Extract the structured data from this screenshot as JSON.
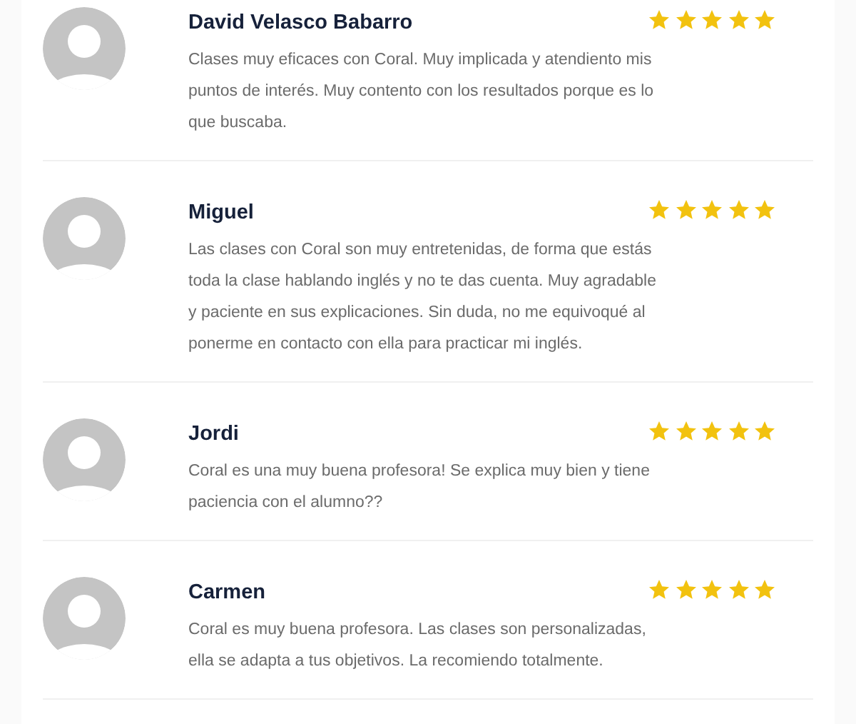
{
  "reviews": [
    {
      "name": "David Velasco Babarro",
      "text": "Clases muy eficaces con Coral. Muy implicada y atendiento mis puntos de interés. Muy contento con los resultados porque es lo que buscaba.",
      "stars": 5
    },
    {
      "name": "Miguel",
      "text": "Las clases con Coral son muy entretenidas, de forma que estás toda la clase hablando inglés y no te das cuenta. Muy agradable y paciente en sus explicaciones. Sin duda, no me equivoqué al ponerme en contacto con ella para practicar mi inglés.",
      "stars": 5
    },
    {
      "name": "Jordi",
      "text": "Coral es una muy buena profesora! Se explica muy bien y tiene paciencia con el alumno??",
      "stars": 5
    },
    {
      "name": "Carmen",
      "text": "Coral es muy buena profesora. Las clases son personalizadas, ella se adapta a tus objetivos. La recomiendo totalmente.",
      "stars": 5
    }
  ]
}
